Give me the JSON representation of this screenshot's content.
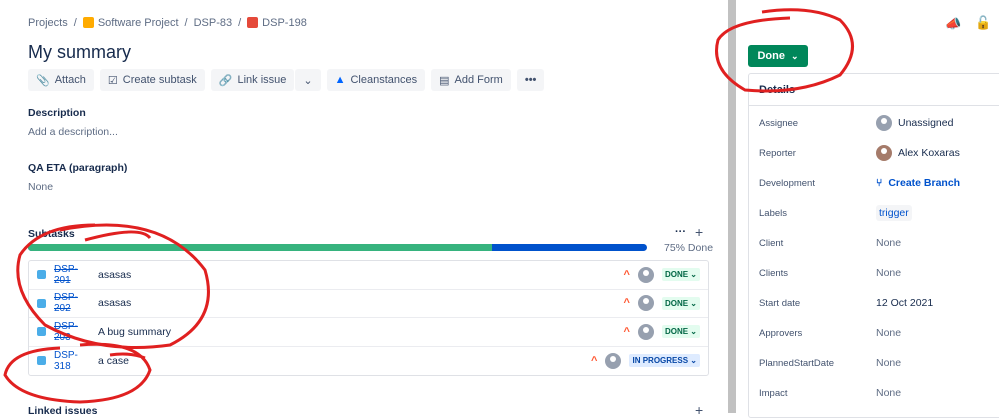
{
  "breadcrumbs": [
    "Projects",
    "Software Project",
    "DSP-83",
    "DSP-198"
  ],
  "title": "My summary",
  "toolbar": {
    "attach": "Attach",
    "create_subtask": "Create subtask",
    "link_issue": "Link issue",
    "cleanstances": "Cleanstances",
    "add_form": "Add Form"
  },
  "description": {
    "label": "Description",
    "placeholder": "Add a description..."
  },
  "qa": {
    "label": "QA ETA (paragraph)",
    "value": "None"
  },
  "subtasks": {
    "label": "Subtasks",
    "progress_percent": 75,
    "progress_text": "75% Done",
    "items": [
      {
        "key": "DSP-201",
        "summary": "asasas",
        "status": "DONE"
      },
      {
        "key": "DSP-202",
        "summary": "asasas",
        "status": "DONE"
      },
      {
        "key": "DSP-203",
        "summary": "A bug summary",
        "status": "DONE"
      },
      {
        "key": "DSP-318",
        "summary": "a case",
        "status": "IN PROGRESS"
      }
    ]
  },
  "linked_issues": {
    "label": "Linked issues"
  },
  "status_button": "Done",
  "details": {
    "title": "Details",
    "fields": [
      {
        "k": "Assignee",
        "v": "Unassigned"
      },
      {
        "k": "Reporter",
        "v": "Alex Koxaras"
      },
      {
        "k": "Development",
        "v": "Create Branch"
      },
      {
        "k": "Labels",
        "v": "trigger"
      },
      {
        "k": "Client",
        "v": "None"
      },
      {
        "k": "Clients",
        "v": "None"
      },
      {
        "k": "Start date",
        "v": "12 Oct 2021"
      },
      {
        "k": "Approvers",
        "v": "None"
      },
      {
        "k": "PlannedStartDate",
        "v": "None"
      },
      {
        "k": "Impact",
        "v": "None"
      }
    ]
  },
  "colors": {
    "done": "#00875a",
    "progress_done": "#36b37e",
    "progress_rest": "#0052cc",
    "annotation": "#e02020"
  }
}
